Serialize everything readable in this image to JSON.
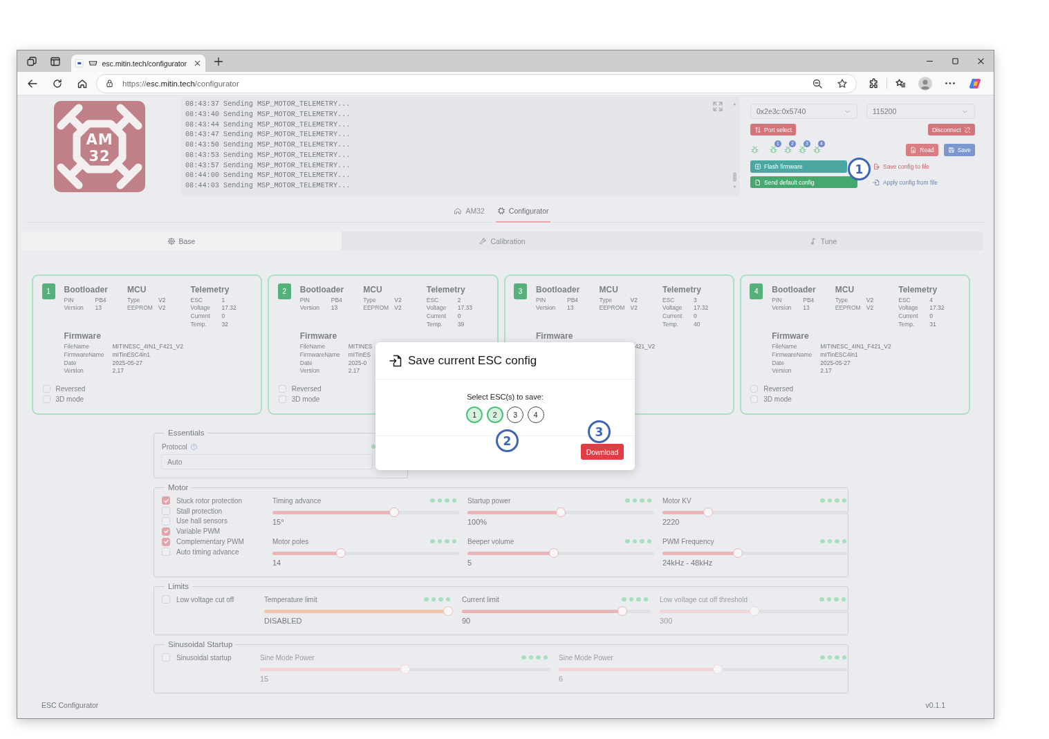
{
  "browser": {
    "tab_title": "esc.mitin.tech/configurator",
    "url": {
      "scheme": "https://",
      "host": "esc.mitin.tech",
      "path": "/configurator"
    }
  },
  "logo": {
    "line_1": "AM",
    "line_2": "32"
  },
  "log": {
    "lines": [
      "08:43:37 Sending MSP_MOTOR_TELEMETRY...",
      "08:43:40 Sending MSP_MOTOR_TELEMETRY...",
      "08:43:44 Sending MSP_MOTOR_TELEMETRY...",
      "08:43:47 Sending MSP_MOTOR_TELEMETRY...",
      "08:43:50 Sending MSP_MOTOR_TELEMETRY...",
      "08:43:53 Sending MSP_MOTOR_TELEMETRY...",
      "08:43:57 Sending MSP_MOTOR_TELEMETRY...",
      "08:44:00 Sending MSP_MOTOR_TELEMETRY...",
      "08:44:03 Sending MSP_MOTOR_TELEMETRY..."
    ]
  },
  "connection": {
    "port": "0x2e3c:0x5740",
    "baud": "115200",
    "port_select": "Port select",
    "disconnect": "Disconnect"
  },
  "esc_indicators": [
    {
      "badge": "1"
    },
    {
      "badge": "2"
    },
    {
      "badge": "3"
    },
    {
      "badge": "4"
    }
  ],
  "actions": {
    "read": "Read",
    "save": "Save",
    "flash_firmware": "Flash firmware",
    "send_default_config": "Send default config",
    "save_config_to_file": "Save config to file",
    "apply_config_from_file": "Apply config from file"
  },
  "nav_tabs": [
    {
      "label": "AM32",
      "selected": false
    },
    {
      "label": "Configurator",
      "selected": true
    }
  ],
  "sub_tabs": [
    {
      "label": "Base",
      "selected": true
    },
    {
      "label": "Calibration",
      "selected": false
    },
    {
      "label": "Tune",
      "selected": false
    }
  ],
  "escs": [
    {
      "number": "1",
      "columns": [
        {
          "title": "Bootloader",
          "rows": [
            {
              "label": "PIN",
              "value": "PB4"
            },
            {
              "label": "Version",
              "value": "13"
            }
          ]
        },
        {
          "title": "MCU",
          "rows": [
            {
              "label": "Type",
              "value": "V2"
            },
            {
              "label": "EEPROM",
              "value": "V2"
            }
          ]
        },
        {
          "title": "Telemetry",
          "rows": [
            {
              "label": "ESC",
              "value": "1"
            },
            {
              "label": "Voltage",
              "value": "17.32"
            },
            {
              "label": "Current",
              "value": "0"
            },
            {
              "label": "Temp.",
              "value": "32"
            }
          ]
        }
      ],
      "firmware": {
        "title": "Firmware",
        "rows": [
          {
            "label": "FileName",
            "value": "MITINESC_4IN1_F421_V2"
          },
          {
            "label": "FirmwareName",
            "value": "mITinESC4in1"
          },
          {
            "label": "Date",
            "value": "2025-05-27"
          },
          {
            "label": "Version",
            "value": "2.17"
          }
        ]
      },
      "options": [
        {
          "label": "Reversed",
          "checked": false
        },
        {
          "label": "3D mode",
          "checked": false
        }
      ]
    },
    {
      "number": "2",
      "columns": [
        {
          "title": "Bootloader",
          "rows": [
            {
              "label": "PIN",
              "value": "PB4"
            },
            {
              "label": "Version",
              "value": "13"
            }
          ]
        },
        {
          "title": "MCU",
          "rows": [
            {
              "label": "Type",
              "value": "V2"
            },
            {
              "label": "EEPROM",
              "value": "V2"
            }
          ]
        },
        {
          "title": "Telemetry",
          "rows": [
            {
              "label": "ESC",
              "value": "2"
            },
            {
              "label": "Voltage",
              "value": "17.33"
            },
            {
              "label": "Current",
              "value": "0"
            },
            {
              "label": "Temp.",
              "value": "39"
            }
          ]
        }
      ],
      "firmware": {
        "title": "Firmware",
        "rows": [
          {
            "label": "FileName",
            "value": "MITINES"
          },
          {
            "label": "FirmwareName",
            "value": "mITinES"
          },
          {
            "label": "Date",
            "value": "2025-0"
          },
          {
            "label": "Version",
            "value": "2.17"
          }
        ]
      },
      "options": [
        {
          "label": "Reversed",
          "checked": false
        },
        {
          "label": "3D mode",
          "checked": false
        }
      ]
    },
    {
      "number": "3",
      "columns": [
        {
          "title": "Bootloader",
          "rows": [
            {
              "label": "PIN",
              "value": "PB4"
            },
            {
              "label": "Version",
              "value": "13"
            }
          ]
        },
        {
          "title": "MCU",
          "rows": [
            {
              "label": "Type",
              "value": "V2"
            },
            {
              "label": "EEPROM",
              "value": "V2"
            }
          ]
        },
        {
          "title": "Telemetry",
          "rows": [
            {
              "label": "ESC",
              "value": "3"
            },
            {
              "label": "Voltage",
              "value": "17.32"
            },
            {
              "label": "Current",
              "value": "0"
            },
            {
              "label": "Temp.",
              "value": "40"
            }
          ]
        }
      ],
      "firmware": {
        "title": "Firmware",
        "rows": [
          {
            "value": "421_V2"
          }
        ]
      }
    },
    {
      "number": "4",
      "columns": [
        {
          "title": "Bootloader",
          "rows": [
            {
              "label": "PIN",
              "value": "PB4"
            },
            {
              "label": "Version",
              "value": "13"
            }
          ]
        },
        {
          "title": "MCU",
          "rows": [
            {
              "label": "Type",
              "value": "V2"
            },
            {
              "label": "EEPROM",
              "value": "V2"
            }
          ]
        },
        {
          "title": "Telemetry",
          "rows": [
            {
              "label": "ESC",
              "value": "4"
            },
            {
              "label": "Voltage",
              "value": "17.32"
            },
            {
              "label": "Current",
              "value": "0"
            },
            {
              "label": "Temp.",
              "value": "31"
            }
          ]
        }
      ],
      "firmware": {
        "title": "Firmware",
        "rows": [
          {
            "label": "FileName",
            "value": "MITINESC_4IN1_F421_V2"
          },
          {
            "label": "FirmwareName",
            "value": "mITinESC4in1"
          },
          {
            "label": "Date",
            "value": "2025-05-27"
          },
          {
            "label": "Version",
            "value": "2.17"
          }
        ]
      },
      "options": [
        {
          "label": "Reversed",
          "checked": false
        },
        {
          "label": "3D mode",
          "checked": false
        }
      ]
    }
  ],
  "essentials": {
    "legend": "Essentials",
    "protocol": {
      "label": "Protocol",
      "value": "Auto"
    }
  },
  "motor": {
    "legend": "Motor",
    "checkboxes": [
      {
        "label": "Stuck rotor protection",
        "checked": true
      },
      {
        "label": "Stall protection",
        "checked": false
      },
      {
        "label": "Use hall sensors",
        "checked": false
      },
      {
        "label": "Variable PWM",
        "checked": true
      },
      {
        "label": "Complementary PWM",
        "checked": true
      },
      {
        "label": "Auto timing advance",
        "checked": false
      }
    ],
    "sliders": [
      {
        "label": "Timing advance",
        "value": "15°",
        "level": 0.66,
        "color": "#e9b5b9",
        "disabled": false
      },
      {
        "label": "Startup power",
        "value": "100%",
        "level": 0.5,
        "color": "#e9b5b9",
        "disabled": false
      },
      {
        "label": "Motor KV",
        "value": "2220",
        "level": 0.23,
        "color": "#e9b5b9",
        "disabled": false
      },
      {
        "label": "Motor poles",
        "value": "14",
        "level": 0.36,
        "color": "#e9b5b9",
        "disabled": false
      },
      {
        "label": "Beeper volume",
        "value": "5",
        "level": 0.46,
        "color": "#e9b5b9",
        "disabled": false
      },
      {
        "label": "PWM Frequency",
        "value": "24kHz - 48kHz",
        "level": 0.4,
        "color": "#e9b5b9",
        "disabled": false
      }
    ]
  },
  "limits": {
    "legend": "Limits",
    "checkboxes": [
      {
        "label": "Low voltage cut off",
        "checked": false
      }
    ],
    "sliders": [
      {
        "label": "Temperature limit",
        "value": "DISABLED",
        "level": 1,
        "color": "#f0c6ae",
        "disabled": false
      },
      {
        "label": "Current limit",
        "value": "90",
        "level": 0.87,
        "color": "#e9b5b9",
        "disabled": false
      },
      {
        "label": "Low voltage cut off threshold",
        "value": "300",
        "level": 0.5,
        "color": "#f0d6d9",
        "disabled": true
      }
    ]
  },
  "sinusoidal_startup": {
    "legend": "Sinusoidal Startup",
    "checkboxes": [
      {
        "label": "Sinusoidal startup",
        "checked": false
      }
    ],
    "sliders": [
      {
        "label": "Sine Mode Power",
        "value": "15",
        "level": 0.5,
        "color": "#f0d6d9",
        "disabled": true
      },
      {
        "label": "Sine Mode Power",
        "value": "6",
        "level": 0.55,
        "color": "#f0d6d9",
        "disabled": true
      }
    ]
  },
  "footer": {
    "app_name": "ESC Configurator",
    "version": "v0.1.1"
  },
  "modal": {
    "title": "Save current ESC config",
    "prompt": "Select ESC(s) to save:",
    "escs": [
      {
        "label": "1",
        "selected": true
      },
      {
        "label": "2",
        "selected": true
      },
      {
        "label": "3",
        "selected": false
      },
      {
        "label": "4",
        "selected": false
      }
    ],
    "download": "Download"
  },
  "callouts": [
    {
      "label": "1"
    },
    {
      "label": "2"
    },
    {
      "label": "3"
    }
  ]
}
